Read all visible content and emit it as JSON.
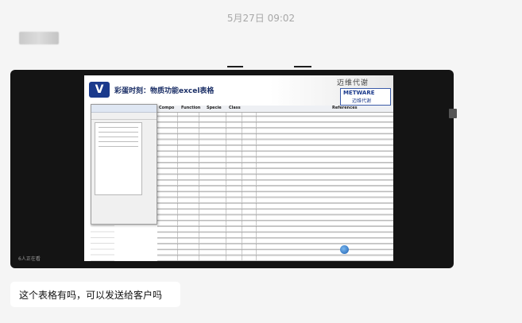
{
  "timestamp": "5月27日 09:02",
  "video": {
    "slide_title": "彩蛋时刻：物质功能excel表格",
    "header_dark_text": "迈维代谢",
    "brand_name_en": "METWARE",
    "brand_name_cn": "迈维代谢",
    "logo_letter": "V",
    "column_headers": [
      "Compo",
      "Function",
      "Specie",
      "Class",
      "References"
    ],
    "viewer_count": "6人正在看"
  },
  "message": {
    "text": "这个表格有吗，可以发送给客户吗"
  }
}
